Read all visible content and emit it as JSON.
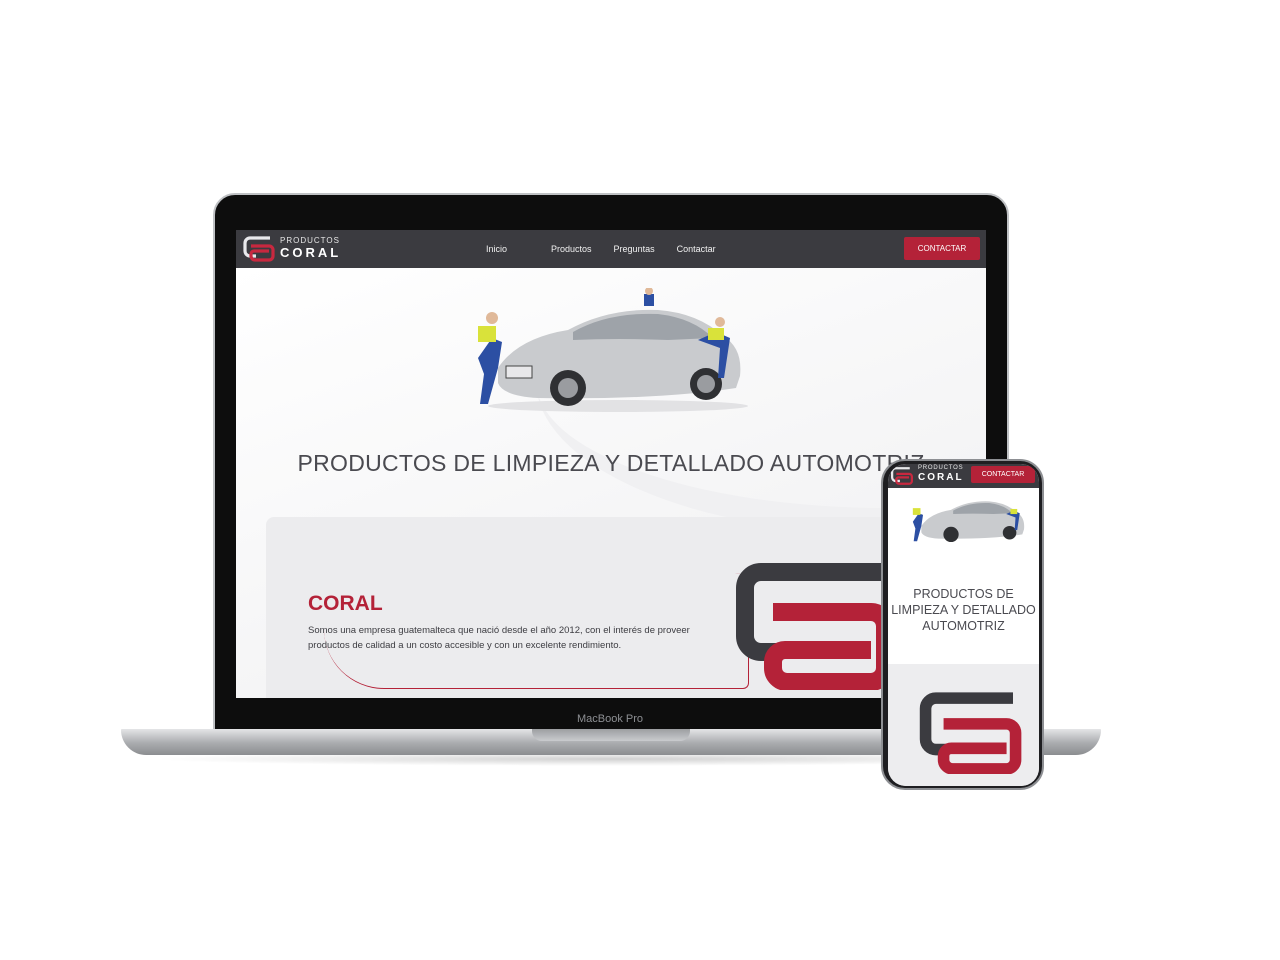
{
  "laptop": {
    "brand_label": "MacBook Pro",
    "navbar": {
      "logo_top": "PRODUCTOS",
      "logo_main": "CORAL",
      "links": [
        "Inicio",
        "Productos",
        "Preguntas",
        "Contactar"
      ],
      "cta": "CONTACTAR"
    },
    "hero": {
      "title": "PRODUCTOS DE LIMPIEZA Y DETALLADO AUTOMOTRIZ"
    },
    "about": {
      "title": "CORAL",
      "text": "Somos una empresa guatemalteca que nació desde el año 2012, con el interés de proveer productos de calidad a un costo accesible y con un excelente rendimiento."
    }
  },
  "phone": {
    "navbar": {
      "logo_top": "PRODUCTOS",
      "logo_main": "CORAL",
      "cta": "CONTACTAR"
    },
    "hero": {
      "title": "PRODUCTOS DE LIMPIEZA Y DETALLADO AUTOMOTRIZ"
    }
  },
  "colors": {
    "brand_red": "#b42238",
    "brand_dark": "#3b3b40"
  },
  "icons": [
    "coral-logo-mark",
    "car-detailing-hero-image"
  ]
}
